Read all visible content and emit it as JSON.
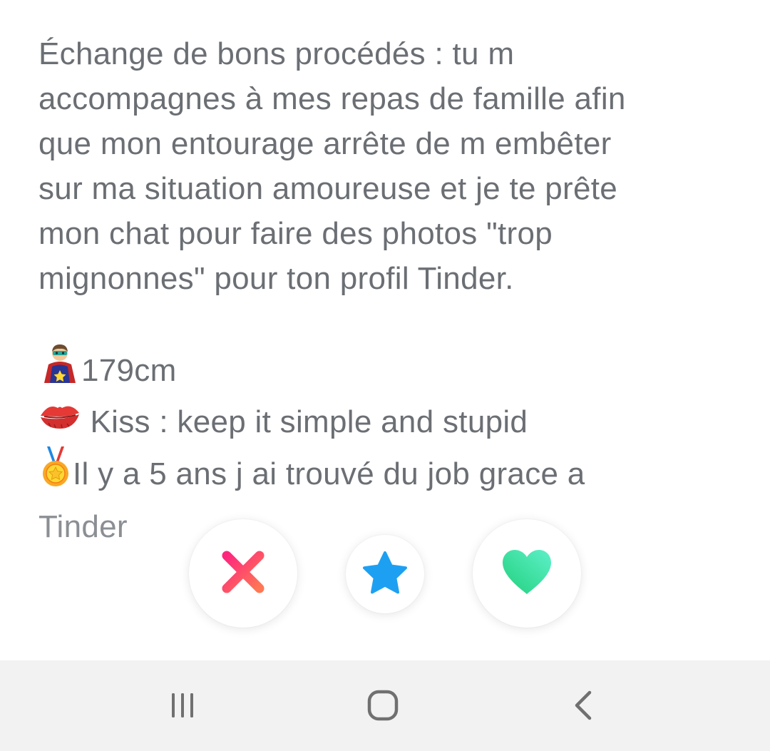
{
  "profile": {
    "bio_lines": [
      "Échange de bons procédés : tu m",
      "accompagnes à mes repas de famille afin",
      "que mon entourage arrête de m embêter",
      "sur ma situation amoureuse et je te prête",
      "mon chat pour faire des photos \"trop",
      "mignonnes\" pour ton profil Tinder."
    ],
    "height": "179cm",
    "kiss": " Kiss : keep it simple and stupid",
    "job_line1": "Il y a 5 ans j ai trouvé du job grace a",
    "job_line2": "Tinder"
  },
  "icons": {
    "superhero": "superhero-emoji",
    "kiss": "kiss-mark-emoji",
    "medal": "medal-emoji",
    "nope": "x-icon",
    "super_like": "star-icon",
    "like": "heart-icon",
    "recent": "recent-apps-icon",
    "home": "home-icon",
    "back": "back-icon"
  },
  "colors": {
    "text": "#6b6f74",
    "nope_start": "#fd267d",
    "nope_end": "#ff7854",
    "super_like": "#1ea0f2",
    "like_start": "#21d07c",
    "like_end": "#5ef0c9",
    "navbar_bg": "#f2f2f2",
    "navbar_icon": "#707070"
  }
}
